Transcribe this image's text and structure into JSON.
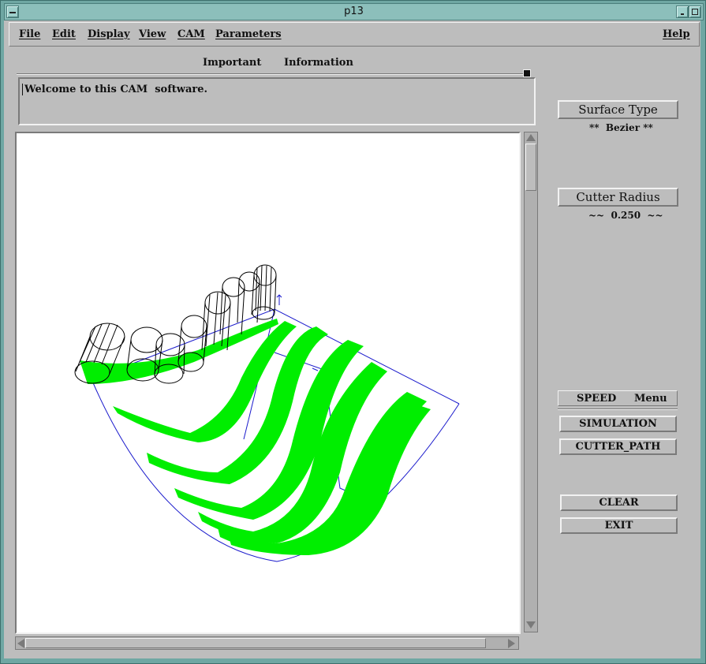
{
  "window": {
    "title": "p13"
  },
  "menu": {
    "file": "File",
    "edit": "Edit",
    "display": "Display",
    "view": "View",
    "cam": "CAM",
    "parameters": "Parameters",
    "help": "Help"
  },
  "info_header": {
    "important": "Important",
    "information": "Information"
  },
  "info": {
    "message": "Welcome to this CAM  software."
  },
  "surface_type": {
    "label": "Surface Type",
    "value": "**  Bezier **"
  },
  "cutter_radius": {
    "label": "Cutter Radius",
    "value": "~~  0.250  ~~"
  },
  "speed_menu": {
    "speed": "SPEED",
    "menu": "Menu"
  },
  "buttons": {
    "simulation": "SIMULATION",
    "cutter_path": "CUTTER_PATH",
    "clear": "CLEAR",
    "exit": "EXIT"
  },
  "colors": {
    "toolpath": "#00ee00",
    "surface_outline": "#1a1acc",
    "cutter_wireframe": "#000000"
  },
  "icons": {
    "window_menu": "window-menu-icon",
    "minimize": "minimize-icon",
    "maximize": "maximize-icon"
  }
}
